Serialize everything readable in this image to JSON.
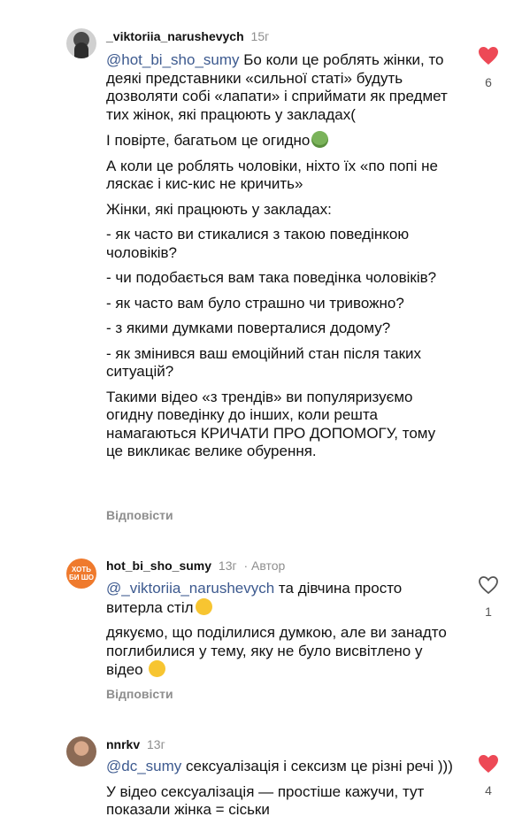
{
  "comments": [
    {
      "username": "_viktoriia_narushevych",
      "time": "15г",
      "mention": "@hot_bi_sho_sumy",
      "paragraphs": [
        "Бо коли це роблять жінки, то деякі представники «сильної статі» будуть дозволяти собі «лапати» і сприймати як предмет тих жінок, які працюють у закладах(",
        "І повірте, багатьом це огидно",
        "А коли це роблять чоловіки, ніхто їх «по попі не ляскає і кис-кис не кричить»",
        "Жінки, які працюють у закладах:",
        "- як часто ви стикалися з такою поведінкою чоловіків?",
        "- чи подобається вам така поведінка чоловіків?",
        "- як часто вам було страшно чи тривожно?",
        "- з якими думками поверталися додому?",
        "- як змінився ваш емоційний стан після таких ситуацій?",
        "Такими відео «з трендів» ви популяризуємо огидну поведінку до інших, коли решта намагаються КРИЧАТИ ПРО ДОПОМОГУ, тому це викликає велике обурення."
      ],
      "reply_label": "Відповісти",
      "likes": "6",
      "liked": true
    },
    {
      "username": "hot_bi_sho_sumy",
      "time": "13г",
      "author_badge": "· Автор",
      "avatar_text": "ХОТЬ БИ ШО",
      "mention": "@_viktoriia_narushevych",
      "paragraphs": [
        "та дівчина просто витерла стіл",
        "дякуємо, що поділилися думкою, але ви занадто поглибилися у тему, яку не було висвітлено у відео"
      ],
      "reply_label": "Відповісти",
      "likes": "1",
      "liked": false
    },
    {
      "username": "nnrkv",
      "time": "13г",
      "mention": "@dc_sumy",
      "paragraphs": [
        "сексуалізація і сексизм це різні речі )))",
        "У відео сексуалізація — простіше кажучи, тут показали жінка = сіськи"
      ],
      "likes": "4",
      "liked": true
    }
  ],
  "colors": {
    "like_red": "#ed4956",
    "mention_blue": "#3d5a8f",
    "muted": "#8e8e8e"
  }
}
